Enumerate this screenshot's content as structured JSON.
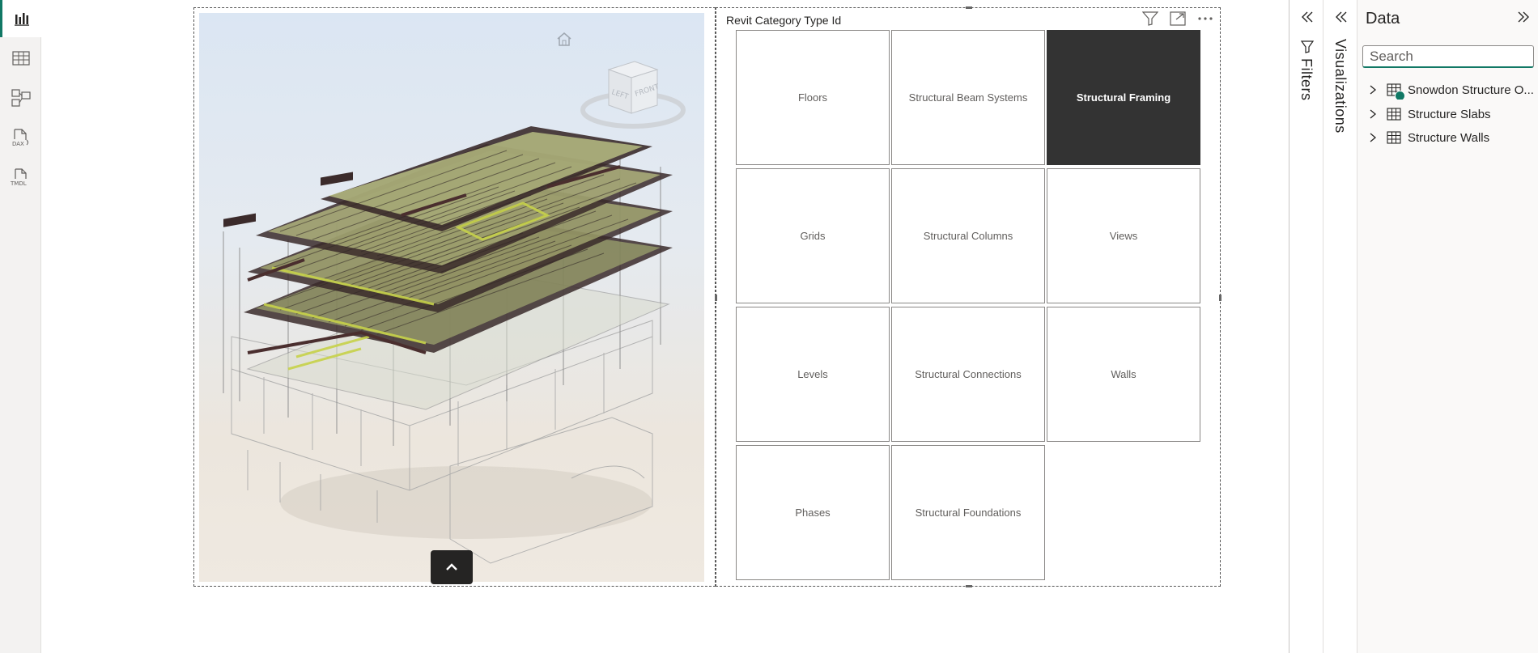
{
  "rail": {
    "items": [
      {
        "name": "report-view",
        "active": true
      },
      {
        "name": "table-view",
        "active": false
      },
      {
        "name": "model-view",
        "active": false
      },
      {
        "name": "dax-query-view",
        "label": "DAX",
        "active": false
      },
      {
        "name": "tmdl-view",
        "label": "TMDL",
        "active": false
      }
    ]
  },
  "viewer": {
    "viewcube_faces": [
      "LEFT",
      "FRONT"
    ]
  },
  "slicer": {
    "title": "Revit Category Type Id",
    "tiles": [
      {
        "label": "Floors",
        "selected": false
      },
      {
        "label": "Structural Beam Systems",
        "selected": false
      },
      {
        "label": "Structural Framing",
        "selected": true
      },
      {
        "label": "Grids",
        "selected": false
      },
      {
        "label": "Structural Columns",
        "selected": false
      },
      {
        "label": "Views",
        "selected": false
      },
      {
        "label": "Levels",
        "selected": false
      },
      {
        "label": "Structural Connections",
        "selected": false
      },
      {
        "label": "Walls",
        "selected": false
      },
      {
        "label": "Phases",
        "selected": false
      },
      {
        "label": "Structural Foundations",
        "selected": false
      }
    ]
  },
  "filters_pane": {
    "label": "Filters"
  },
  "viz_pane": {
    "label": "Visualizations"
  },
  "data_pane": {
    "title": "Data",
    "search_placeholder": "Search",
    "tables": [
      {
        "label": "Snowdon Structure O...",
        "has_badge": true
      },
      {
        "label": "Structure Slabs",
        "has_badge": false
      },
      {
        "label": "Structure Walls",
        "has_badge": false
      }
    ]
  },
  "colors": {
    "accent": "#117865",
    "selected_tile": "#333333",
    "framing_dark": "#4a2e2e",
    "framing_yellow": "#c7d26a"
  }
}
